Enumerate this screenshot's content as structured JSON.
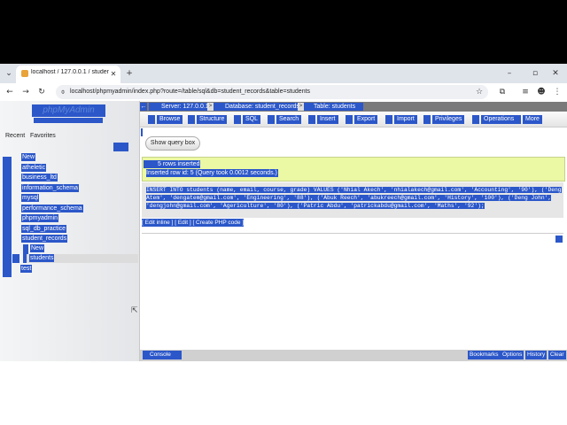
{
  "browser": {
    "tab_title": "localhost / 127.0.0.1 / student_r",
    "url": "localhost/phpmyadmin/index.php?route=/table/sql&db=student_records&table=students"
  },
  "sidebar": {
    "logo": "phpMyAdmin",
    "tab_recent": "Recent",
    "tab_favorites": "Favorites",
    "tree": [
      "New",
      "atheletic",
      "business_ltd",
      "information_schema",
      "mysql",
      "performance_schema",
      "phpmyadmin",
      "sql_db_practice",
      "student_records"
    ],
    "sub_tree": [
      "New",
      "students"
    ],
    "last": "test"
  },
  "breadcrumb": {
    "server": "Server: 127.0.0.1",
    "database": "Database: student_records",
    "table": "Table: students"
  },
  "tabs": [
    "Browse",
    "Structure",
    "SQL",
    "Search",
    "Insert",
    "Export",
    "Import",
    "Privileges",
    "Operations",
    "More"
  ],
  "query_box_label": "Show query box",
  "result": {
    "line1": "5 rows inserted.",
    "line2": "Inserted row id: 5 (Query took 0.0012 seconds.)"
  },
  "sql": [
    "INSERT INTO students (name, email, course, grade) VALUES ('Nhial Akech', 'nhialakech@gmail.com', 'Accounting', '90'), ('Deng",
    "Atem', 'dengatem@gmail.com', 'Engineering', '88'), ('Abuk Reech', 'abukreech@gmail.com', 'History', '100'), ('Deng John',",
    "'dengjohn@gmail.com', 'Agericulture', '80'), ('Patric Abdu', 'patrickabdu@gmail.com', 'Maths', '92');"
  ],
  "links": "[ Edit inline ] [ Edit ] [ Create PHP code ]",
  "console": {
    "label": "Console",
    "buttons": [
      "Bookmarks",
      "Options",
      "History",
      "Clear"
    ]
  }
}
